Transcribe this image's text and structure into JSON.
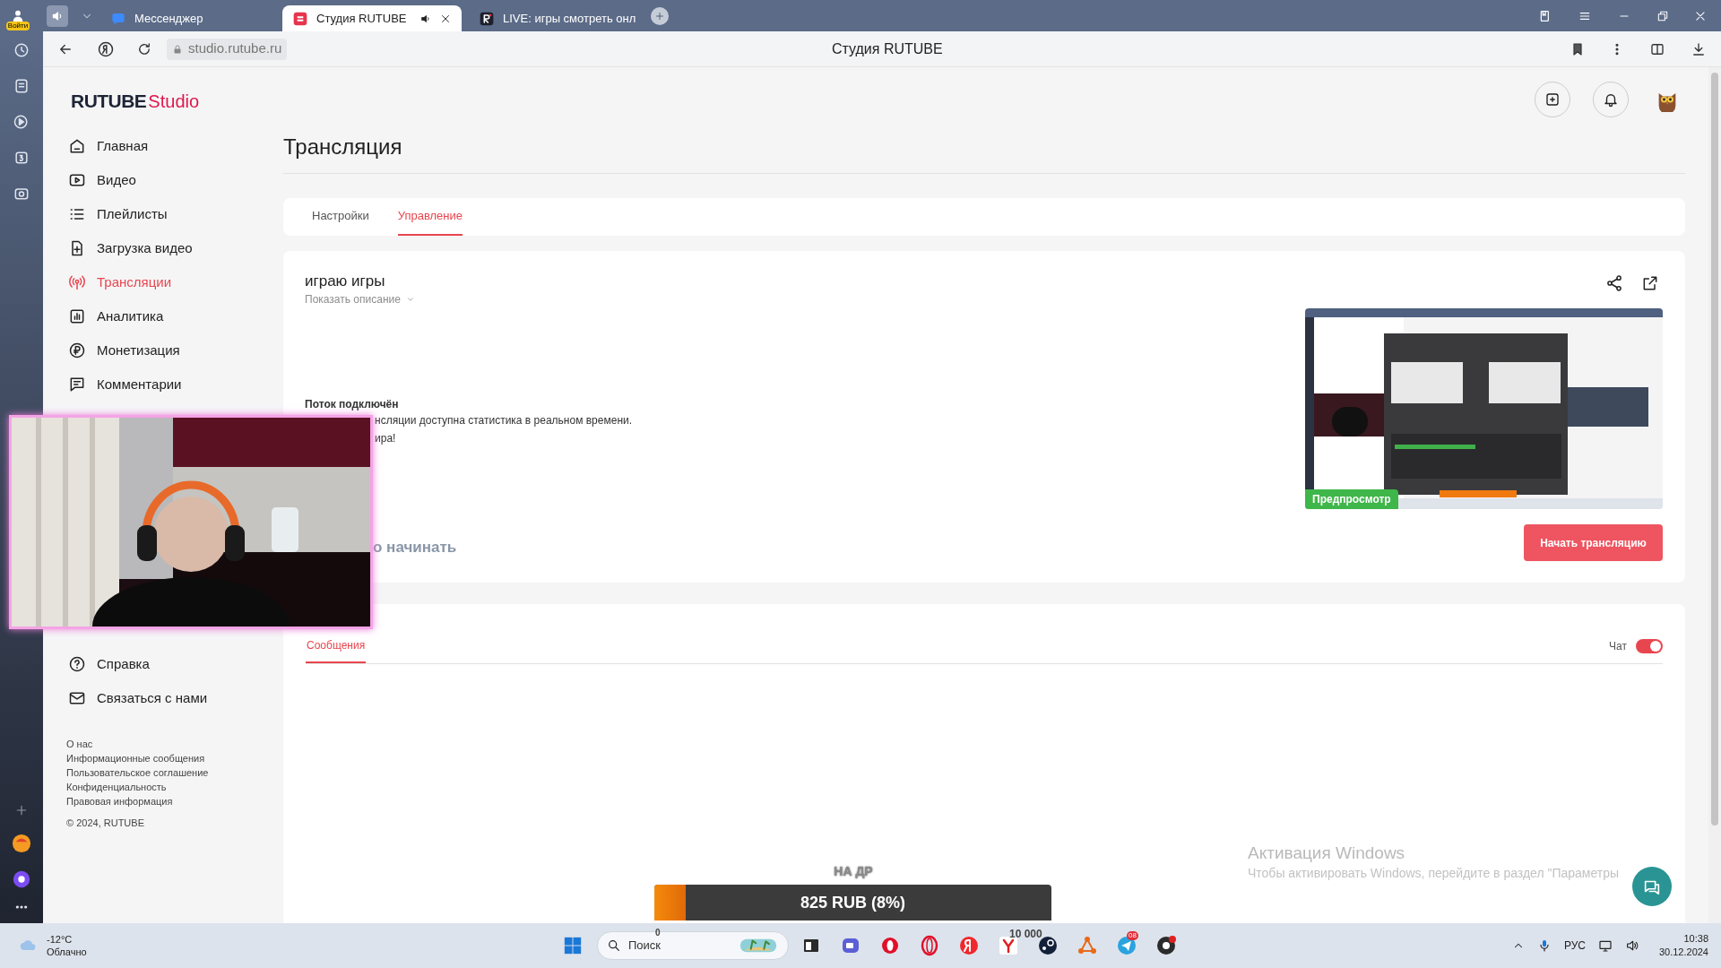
{
  "browser": {
    "profile_label": "Войти",
    "tabs": [
      {
        "label": "Мессенджер",
        "selected": false,
        "kind": "bubble",
        "audio": false
      },
      {
        "label": "Студия RUTUBE",
        "selected": true,
        "kind": "studio",
        "audio": true
      },
      {
        "label": "LIVE: игры смотреть онл",
        "selected": false,
        "kind": "live",
        "audio": false
      }
    ],
    "url": "studio.rutube.ru",
    "page_title": "Студия RUTUBE"
  },
  "studio": {
    "logo": {
      "brand": "RUTUBE",
      "suffix": "Studio"
    },
    "nav": [
      {
        "label": "Главная",
        "kind": "home",
        "selected": false
      },
      {
        "label": "Видео",
        "kind": "video",
        "selected": false
      },
      {
        "label": "Плейлисты",
        "kind": "list",
        "selected": false
      },
      {
        "label": "Загрузка видео",
        "kind": "upload",
        "selected": false
      },
      {
        "label": "Трансляции",
        "kind": "broadcast",
        "selected": true
      },
      {
        "label": "Аналитика",
        "kind": "chart",
        "selected": false
      },
      {
        "label": "Монетизация",
        "kind": "ruble",
        "selected": false
      },
      {
        "label": "Комментарии",
        "kind": "comment",
        "selected": false
      }
    ],
    "nav_bottom": [
      {
        "label": "Справка",
        "kind": "help",
        "selected": false
      },
      {
        "label": "Связаться с нами",
        "kind": "mail",
        "selected": false
      }
    ],
    "footer_links": [
      "О нас",
      "Информационные сообщения",
      "Пользовательское соглашение",
      "Конфиденциальность",
      "Правовая информация"
    ],
    "copyright": "© 2024, RUTUBE"
  },
  "page": {
    "title": "Трансляция",
    "tabs": [
      {
        "label": "Настройки",
        "selected": false
      },
      {
        "label": "Управление",
        "selected": true
      }
    ],
    "stream": {
      "title": "играю игры",
      "show_description": "Показать описание",
      "status_title": "Поток подключён",
      "status_lines": [
        "нсляции доступна статистика в реальном времени.",
        "ира!"
      ],
      "hint": "о начинать",
      "preview_badge": "Предпросмотр",
      "start_button": "Начать трансляцию"
    },
    "chat": {
      "tabs": [
        {
          "label": "Сообщения",
          "selected": true
        }
      ],
      "toggle_label": "Чат",
      "toggle_on": true
    }
  },
  "overlay": {
    "goal_title": "НА ДР",
    "goal_amount": "825 RUB (8%)",
    "level": 0.08,
    "min_label": "0",
    "max_label": "10 000"
  },
  "windows_notice": {
    "title": "Активация Windows",
    "text": "Чтобы активировать Windows, перейдите в раздел \"Параметры"
  },
  "taskbar": {
    "temperature": "-12°C",
    "condition": "Облачно",
    "search_placeholder": "Поиск",
    "telegram_badge": "08",
    "language": "РУС",
    "time": "10:38",
    "date": "30.12.2024"
  }
}
